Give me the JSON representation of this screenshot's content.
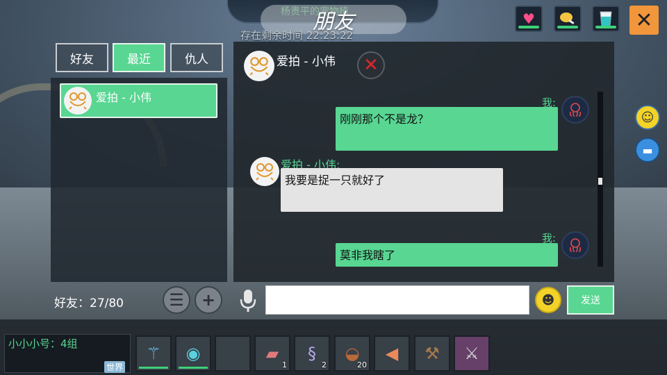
{
  "hud": {
    "banner_text": "杨贵平的宠物植",
    "title": "朋友",
    "timer": "存在剩余时间 22:23:22",
    "icons": [
      "heart-icon",
      "meat-icon",
      "drink-icon"
    ],
    "close_symbol": "✕"
  },
  "tabs": [
    {
      "label": "好友",
      "active": false
    },
    {
      "label": "最近",
      "active": true
    },
    {
      "label": "仇人",
      "active": false
    }
  ],
  "friend_list": [
    {
      "name": "爱拍 - 小伟"
    }
  ],
  "friend_count": "好友：27/80",
  "chat": {
    "header_name": "爱拍 - 小伟",
    "me_label": "我:",
    "other_label": "爱拍 - 小伟:",
    "messages": [
      {
        "from": "me",
        "text": "刚刚那个不是龙？"
      },
      {
        "from": "other",
        "text": "我要是捉一只就好了"
      },
      {
        "from": "me",
        "text": "莫非我瞎了"
      }
    ]
  },
  "input": {
    "value": "",
    "send_label": "发送"
  },
  "bottom": {
    "channel_text": "小小小号：4组",
    "world_badge": "世界",
    "slots": [
      {
        "icon": "staff-icon",
        "count": ""
      },
      {
        "icon": "orb-icon",
        "count": ""
      },
      {
        "icon": "empty-slot",
        "count": ""
      },
      {
        "icon": "raw-meat-icon",
        "count": "1"
      },
      {
        "icon": "tentacle-icon",
        "count": "2"
      },
      {
        "icon": "bowl-icon",
        "count": "20"
      },
      {
        "icon": "fish-icon",
        "count": ""
      },
      {
        "icon": "axe-icon",
        "count": ""
      },
      {
        "icon": "sword-icon",
        "count": ""
      }
    ]
  },
  "colors": {
    "accent": "#58d692",
    "close": "#f2963b",
    "panel": "#222830"
  }
}
